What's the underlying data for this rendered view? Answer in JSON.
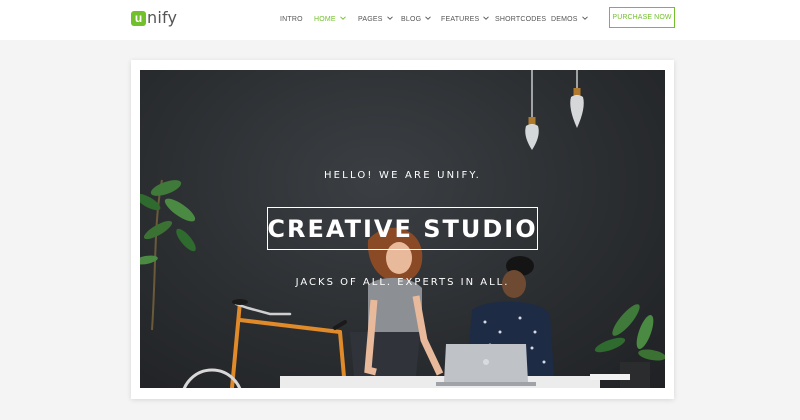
{
  "brand": {
    "logo_mark": "u",
    "logo_text": "nify",
    "accent": "#72c02c"
  },
  "nav": {
    "items": [
      {
        "label": "INTRO",
        "dropdown": false,
        "active": false
      },
      {
        "label": "HOME",
        "dropdown": true,
        "active": true
      },
      {
        "label": "PAGES",
        "dropdown": true,
        "active": false
      },
      {
        "label": "BLOG",
        "dropdown": true,
        "active": false
      },
      {
        "label": "FEATURES",
        "dropdown": true,
        "active": false
      },
      {
        "label": "SHORTCODES",
        "dropdown": false,
        "active": false
      },
      {
        "label": "DEMOS",
        "dropdown": true,
        "active": false
      }
    ],
    "cta_label": "PURCHASE NOW"
  },
  "hero": {
    "eyebrow": "HELLO! WE ARE UNIFY.",
    "title": "CREATIVE STUDIO",
    "tagline": "JACKS OF ALL. EXPERTS IN ALL."
  },
  "icons": {
    "caret": "chevron-down-icon"
  }
}
